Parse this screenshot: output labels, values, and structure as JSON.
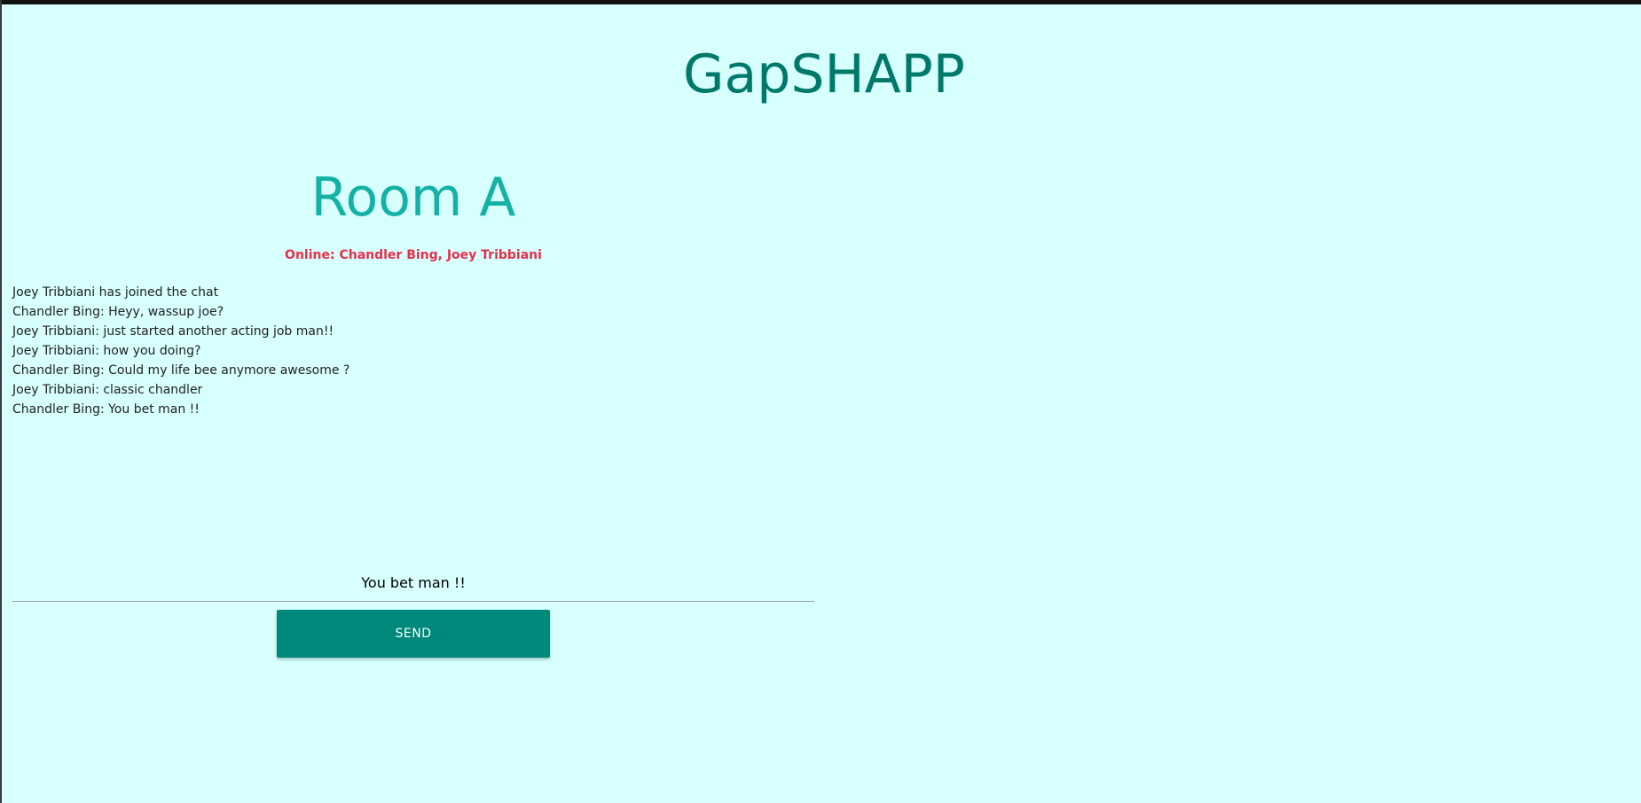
{
  "app": {
    "title": "GapSHAPP"
  },
  "room": {
    "title": "Room A",
    "online_text": "Online: Chandler Bing, Joey Tribbiani"
  },
  "messages": [
    "Joey Tribbiani has joined the chat",
    "Chandler Bing: Heyy, wassup joe?",
    "Joey Tribbiani: just started another acting job man!!",
    "Joey Tribbiani: how you doing?",
    "Chandler Bing: Could my life bee anymore awesome ?",
    "Joey Tribbiani: classic chandler",
    "Chandler Bing: You bet man !!"
  ],
  "composer": {
    "input_value": "You bet man !!",
    "send_label": "SEND"
  },
  "colors": {
    "background": "#d6fffe",
    "app_title": "#00796b",
    "room_title": "#14b1a5",
    "online_text": "#e8304a",
    "send_button": "#00897b"
  }
}
